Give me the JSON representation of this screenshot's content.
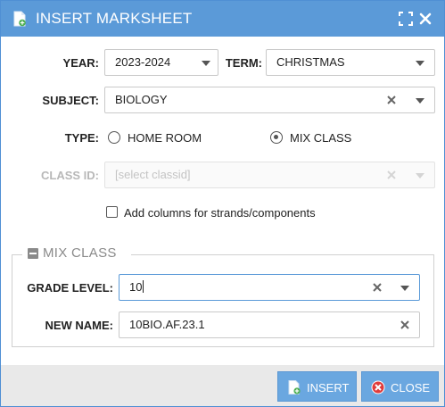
{
  "dialog": {
    "title": "INSERT MARKSHEET",
    "icons": {
      "title": "document-add-icon",
      "maximize": "maximize-icon",
      "close": "close-icon"
    }
  },
  "form": {
    "year": {
      "label": "YEAR:",
      "value": "2023-2024"
    },
    "term": {
      "label": "TERM:",
      "value": "CHRISTMAS"
    },
    "subject": {
      "label": "SUBJECT:",
      "value": "BIOLOGY"
    },
    "type": {
      "label": "TYPE:",
      "options": [
        {
          "label": "HOME ROOM",
          "selected": false
        },
        {
          "label": "MIX CLASS",
          "selected": true
        }
      ]
    },
    "class_id": {
      "label": "CLASS ID:",
      "placeholder": "[select classid]",
      "disabled": true
    },
    "strands_checkbox": {
      "label": "Add columns for strands/components",
      "checked": false
    }
  },
  "mix_class": {
    "legend": "MIX CLASS",
    "grade_level": {
      "label": "GRADE LEVEL:",
      "value": "10"
    },
    "new_name": {
      "label": "NEW NAME:",
      "value": "10BIO.AF.23.1"
    }
  },
  "footer": {
    "insert_label": "INSERT",
    "close_label": "CLOSE"
  },
  "colors": {
    "titlebar": "#5b9ad8",
    "button": "#6aa7e0",
    "footer": "#e9e9e9",
    "close_icon_red": "#e03b3b"
  }
}
